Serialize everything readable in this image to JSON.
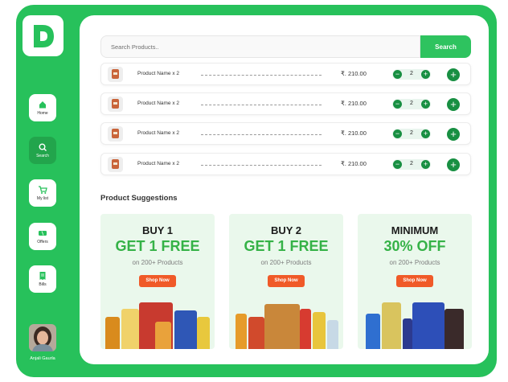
{
  "brand": {
    "logo_letter": "D",
    "accent": "#27c15b",
    "dark_accent": "#188f42"
  },
  "sidebar": {
    "items": [
      {
        "label": "Home",
        "icon": "home-icon"
      },
      {
        "label": "Search",
        "icon": "search-icon",
        "active": true
      },
      {
        "label": "My list",
        "icon": "cart-icon"
      },
      {
        "label": "Offers",
        "icon": "ticket-icon"
      },
      {
        "label": "Bills",
        "icon": "receipt-icon"
      }
    ],
    "user_name": "Anjali Gaurla"
  },
  "search": {
    "placeholder": "Search Products..",
    "button_label": "Search"
  },
  "cart": {
    "items": [
      {
        "name": "Product Name x 2",
        "price": "₹. 210.00",
        "qty": "2"
      },
      {
        "name": "Product Name x 2",
        "price": "₹. 210.00",
        "qty": "2"
      },
      {
        "name": "Product Name x 2",
        "price": "₹. 210.00",
        "qty": "2"
      },
      {
        "name": "Product Name x 2",
        "price": "₹. 210.00",
        "qty": "2"
      }
    ]
  },
  "suggestions": {
    "title": "Product Suggestions",
    "cards": [
      {
        "line1": "BUY 1",
        "line2": "GET 1 FREE",
        "sub": "on 200+ Products",
        "cta": "Shop Now"
      },
      {
        "line1": "BUY 2",
        "line2": "GET 1 FREE",
        "sub": "on 200+ Products",
        "cta": "Shop Now"
      },
      {
        "line1": "MINIMUM",
        "line2": "30% OFF",
        "sub": "on 200+ Products",
        "cta": "Shop Now"
      }
    ]
  }
}
